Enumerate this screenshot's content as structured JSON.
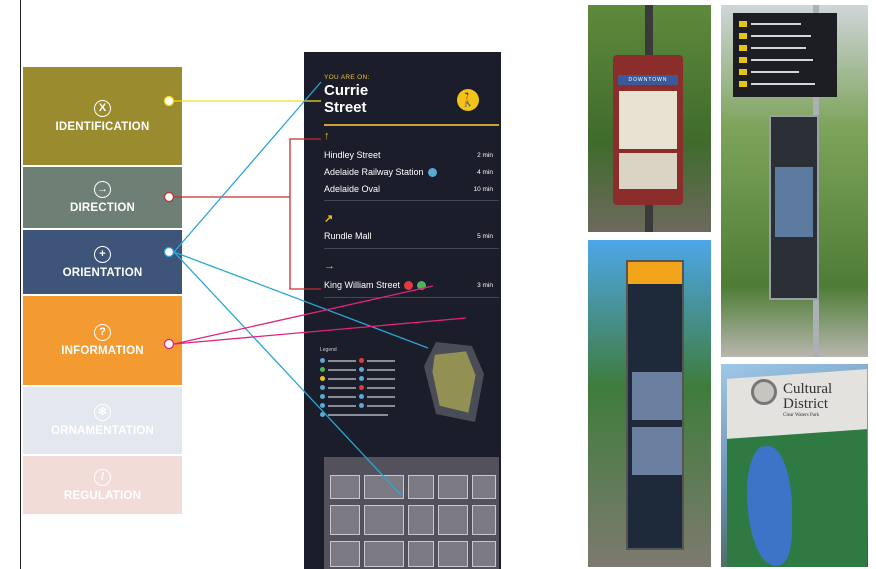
{
  "categories": [
    {
      "icon": "X",
      "label": "IDENTIFICATION",
      "color": "#9a8b2e"
    },
    {
      "icon": "→",
      "label": "DIRECTION",
      "color": "#6e8076"
    },
    {
      "icon": "+",
      "label": "ORIENTATION",
      "color": "#3f5479"
    },
    {
      "icon": "?",
      "label": "INFORMATION",
      "color": "#f39a30"
    },
    {
      "icon": "✻",
      "label": "ORNAMENTATION",
      "color": "#e3e7ee"
    },
    {
      "icon": "/",
      "label": "REGULATION",
      "color": "#f1dcd8"
    }
  ],
  "connector_colors": {
    "identification": "#f5dc1a",
    "direction": "#c0302e",
    "orientation": "#2aa7d6",
    "information": "#e0247c"
  },
  "sign": {
    "you_are_on": "YOU ARE ON:",
    "street_line1": "Currie",
    "street_line2": "Street",
    "groups": [
      {
        "arrow": "↑",
        "items": [
          {
            "name": "Hindley Street",
            "time": "2 min"
          },
          {
            "name": "Adelaide Railway Station",
            "time": "4 min"
          },
          {
            "name": "Adelaide Oval",
            "time": "10 min"
          }
        ]
      },
      {
        "arrow": "↗",
        "items": [
          {
            "name": "Rundle Mall",
            "time": "5 min"
          }
        ]
      },
      {
        "arrow": "→",
        "items": [
          {
            "name": "King William Street",
            "time": "3 min"
          }
        ]
      }
    ],
    "legend_title": "Legend"
  },
  "photos": {
    "downtown_label": "DOWNTOWN",
    "cultural_title": "Cultural District",
    "cultural_sub": "Clear Waters Park"
  }
}
